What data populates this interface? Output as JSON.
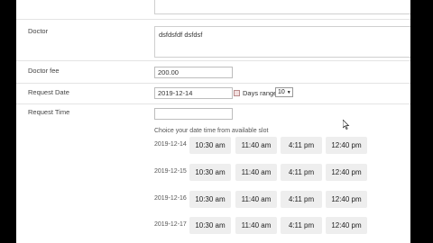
{
  "form": {
    "doctor_label": "Doctor",
    "doctor_value": "dsfdsfdf dsfdsf",
    "fee_label": "Doctor fee",
    "fee_value": "200.00",
    "request_date_label": "Request Date",
    "request_date_value": "2019-12-14",
    "days_range_label": "Days range",
    "days_range_value": "10",
    "request_time_label": "Request Time",
    "slot_hint": "Choice your date time from available slot"
  },
  "slots": [
    {
      "date": "2019-12-14",
      "times": [
        "10:30 am",
        "11:40 am",
        "4:11 pm",
        "12:40 pm"
      ]
    },
    {
      "date": "2019-12-15",
      "times": [
        "10:30 am",
        "11:40 am",
        "4:11 pm",
        "12:40 pm"
      ]
    },
    {
      "date": "2019-12-16",
      "times": [
        "10:30 am",
        "11:40 am",
        "4:11 pm",
        "12:40 pm"
      ]
    },
    {
      "date": "2019-12-17",
      "times": [
        "10:30 am",
        "11:40 am",
        "4:11 pm",
        "12:40 pm"
      ]
    }
  ]
}
